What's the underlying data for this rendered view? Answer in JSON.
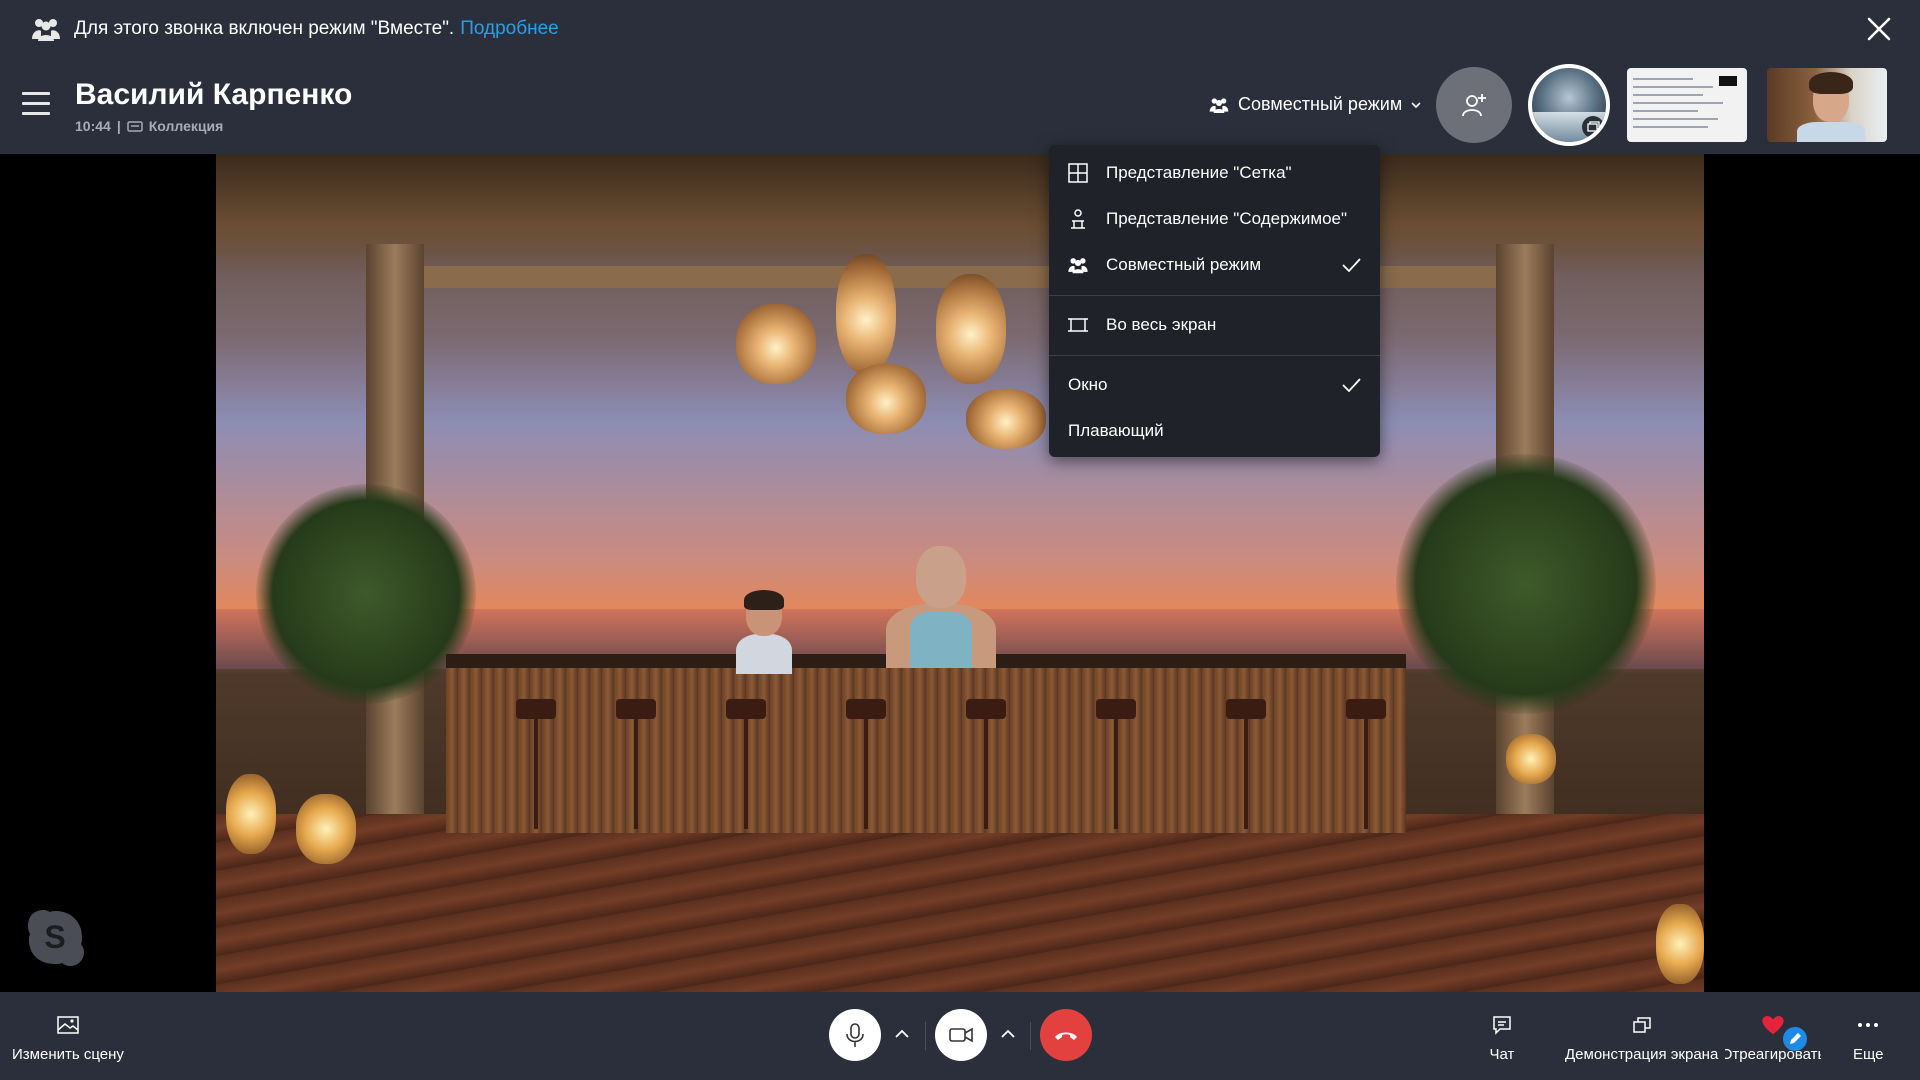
{
  "banner": {
    "text": "Для этого звонка включен режим \"Вместе\".",
    "link": "Подробнее"
  },
  "header": {
    "caller_name": "Василий Карпенко",
    "time": "10:44",
    "separator": "|",
    "collection": "Коллекция",
    "mode_label": "Совместный режим"
  },
  "menu": {
    "items": [
      {
        "label": "Представление \"Сетка\"",
        "icon": "grid-icon",
        "checked": false
      },
      {
        "label": "Представление \"Содержимое\"",
        "icon": "speaker-view-icon",
        "checked": false
      },
      {
        "label": "Совместный режим",
        "icon": "together-mode-icon",
        "checked": true
      },
      {
        "label": "Во весь экран",
        "icon": "fullscreen-icon",
        "checked": false
      },
      {
        "label": "Окно",
        "checked": true
      },
      {
        "label": "Плавающий",
        "checked": false
      }
    ]
  },
  "bottom": {
    "change_scene": "Изменить сцену",
    "chat": "Чат",
    "screen_share": "Демонстрация экрана",
    "react": "Отреагировать",
    "more": "Еще"
  },
  "colors": {
    "panel": "#2b2f3b",
    "menu": "#1f2229",
    "link": "#2a9fe6",
    "end_call": "#e34040",
    "heart": "#e5243b"
  }
}
